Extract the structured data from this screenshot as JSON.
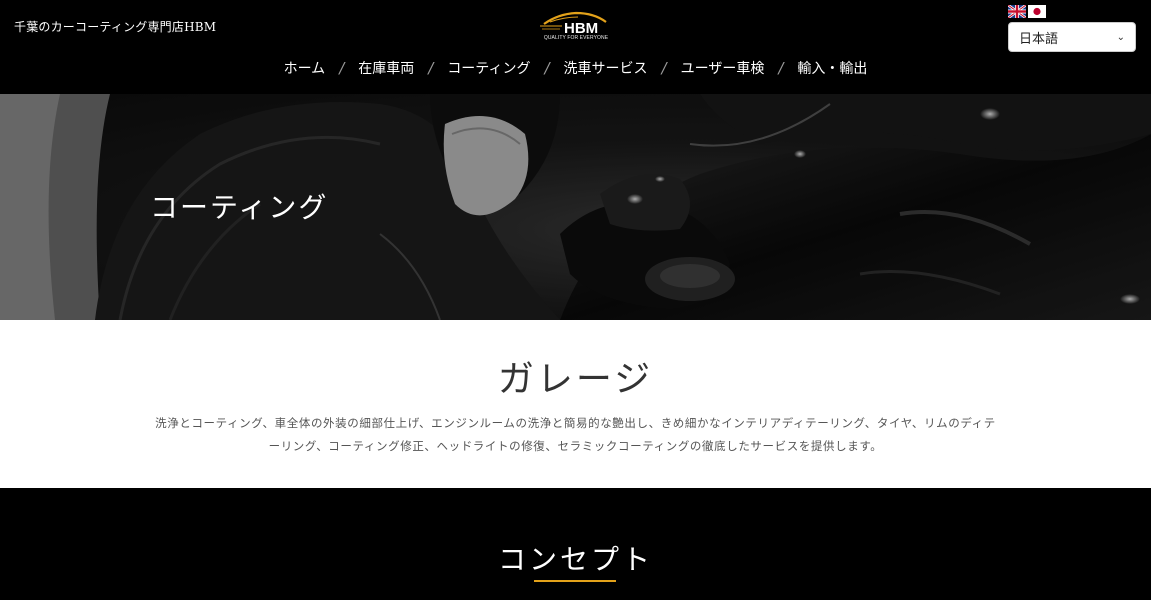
{
  "header": {
    "site_name": "千葉のカーコーティング専門店HBM",
    "logo": {
      "text": "HBM",
      "tagline": "QUALITY FOR EVERYONE",
      "accent_color": "#e3a21a"
    },
    "language": {
      "flags": [
        "uk-flag",
        "japan-flag"
      ],
      "selected": "日本語"
    }
  },
  "nav": {
    "items": [
      {
        "label": "ホーム"
      },
      {
        "label": "在庫車両"
      },
      {
        "label": "コーティング"
      },
      {
        "label": "洗車サービス"
      },
      {
        "label": "ユーザー車検"
      },
      {
        "label": "輸入・輸出"
      }
    ],
    "separator": "/"
  },
  "hero": {
    "title": "コーティング"
  },
  "garage": {
    "title": "ガレージ",
    "description_line1": "洗浄とコーティング、車全体の外装の細部仕上げ、エンジンルームの洗浄と簡易的な艶出し、きめ細かなインテリアディテーリング、タイヤ、リムのディテ",
    "description_line2": "ーリング、コーティング修正、ヘッドライトの修復、セラミックコーティングの徹底したサービスを提供します。"
  },
  "concept": {
    "title": "コンセプト",
    "accent_color": "#e3a21a"
  }
}
